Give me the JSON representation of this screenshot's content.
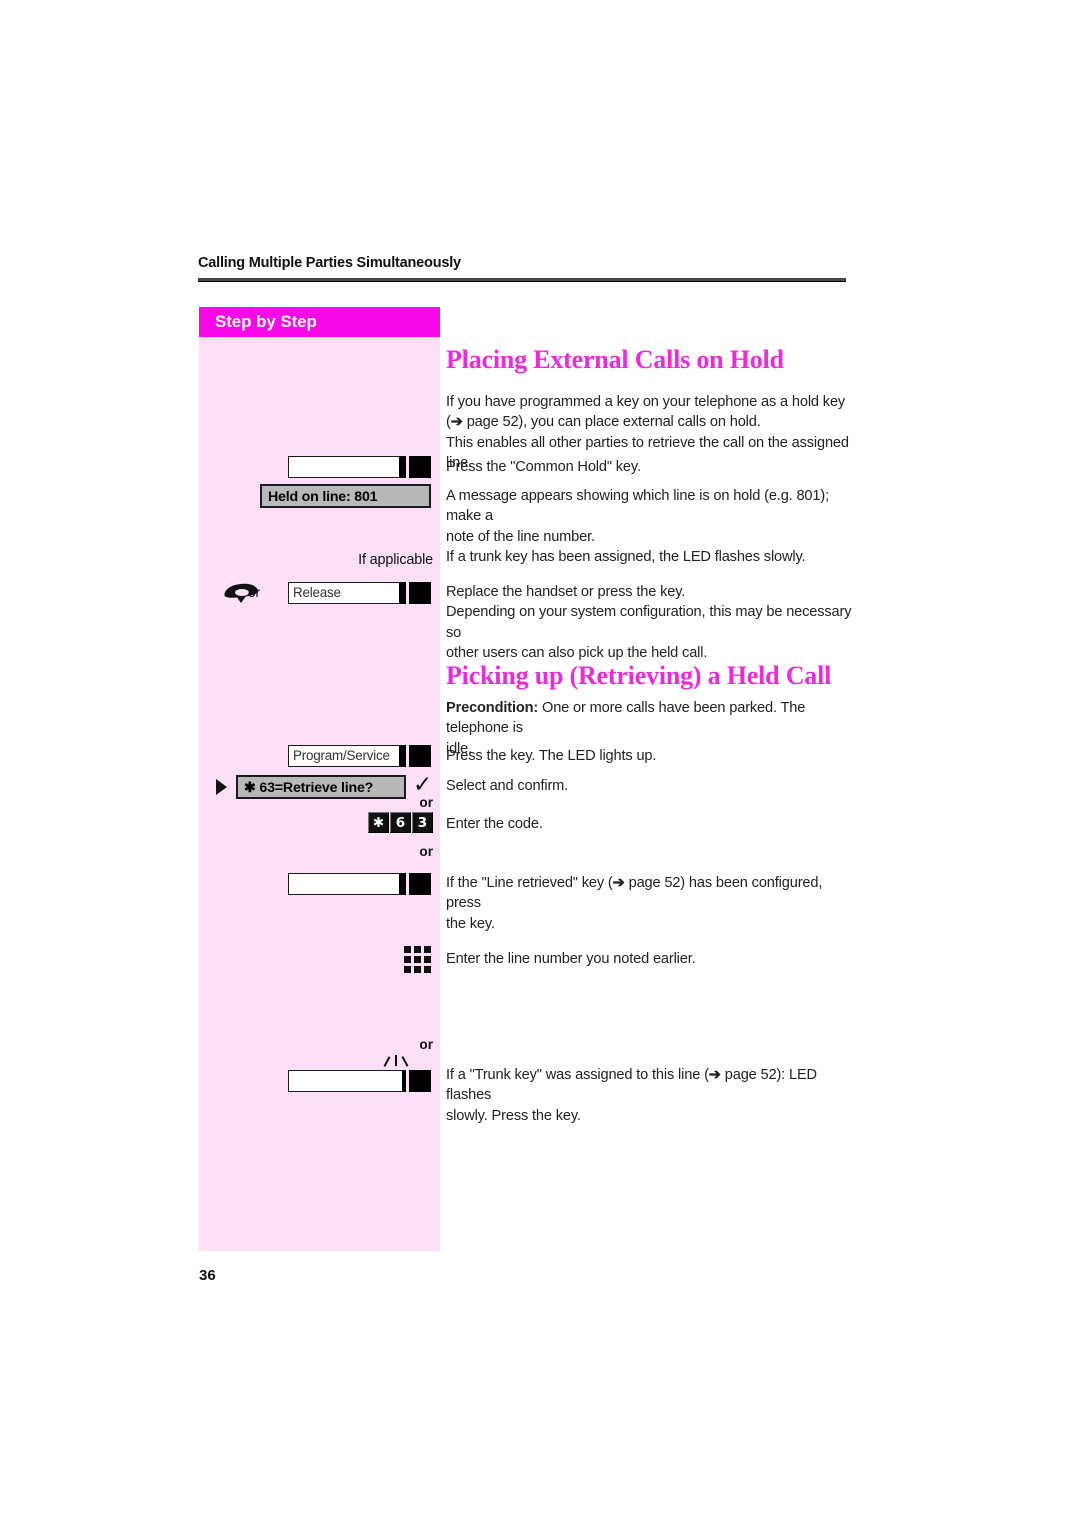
{
  "document": {
    "running_header": "Calling Multiple Parties Simultaneously",
    "page_number": "36",
    "sidebar_label": "Step by Step",
    "colors": {
      "magenta_bar": "#f907e8",
      "sidebar_pink": "#fde0f7",
      "heading_pink": "#f229d8",
      "display_gray": "#b8b8b8"
    }
  },
  "sections": [
    {
      "heading": "Placing External Calls on Hold",
      "intro": {
        "line1": "If you have programmed a key on your telephone as a hold key",
        "line2_pre": "(",
        "line2_arrow": "➔",
        "line2_post": " page 52), you can place external calls on hold.",
        "line3": "This enables all other parties to retrieve the call on the assigned line."
      },
      "steps": [
        {
          "id": "common-hold-key",
          "widget": "function-key",
          "cap_label": "",
          "text": "Press the \"Common Hold\" key."
        },
        {
          "id": "held-on-line-display",
          "widget": "display",
          "display_text": "Held on line: 801",
          "text_line1": "A message appears showing which line is on hold (e.g. 801); make a",
          "text_line2": "note of the line number.",
          "text_line3": "If a trunk key has been assigned, the LED flashes slowly."
        },
        {
          "id": "if-applicable",
          "widget": "note",
          "note": "If applicable"
        },
        {
          "id": "release-key",
          "widget": "handset-or-key",
          "or_label": "or",
          "cap_label": "Release",
          "text_line1": "Replace the handset or press the key.",
          "text_line2": "Depending on your system configuration, this may be necessary so",
          "text_line3": "other users can also pick up the held call."
        }
      ]
    },
    {
      "heading": "Picking up (Retrieving) a Held Call",
      "precondition": {
        "label": "Precondition:",
        "line1": " One or more calls have been parked. The telephone is",
        "line2": "idle."
      },
      "steps": [
        {
          "id": "program-service-key",
          "widget": "function-key",
          "cap_label": "Program/Service",
          "text": "Press the key. The LED lights up."
        },
        {
          "id": "retrieve-line-menu",
          "widget": "display-select",
          "display_text": "✱ 63=Retrieve line?",
          "confirm_glyph": "✓",
          "text": "Select and confirm."
        },
        {
          "id": "enter-code",
          "widget": "keypad-code",
          "or_label": "or",
          "keys": [
            "✱",
            "6",
            "3"
          ],
          "text": "Enter the code."
        },
        {
          "id": "line-retrieved-key",
          "widget": "function-key",
          "or_label": "or",
          "cap_label": "",
          "text_pre": "If the \"Line retrieved\" key (",
          "text_arrow": "➔",
          "text_post": " page 52) has been configured, press",
          "text_line2": "the key."
        },
        {
          "id": "enter-line-number",
          "widget": "dialpad",
          "text": "Enter the line number you noted earlier."
        },
        {
          "id": "trunk-key-flashing",
          "widget": "function-key-flashing",
          "or_label": "or",
          "cap_label": "",
          "text_pre": "If a \"Trunk key\" was assigned to this line (",
          "text_arrow": "➔",
          "text_post": " page 52): LED flashes",
          "text_line2": "slowly. Press the key."
        }
      ]
    }
  ]
}
